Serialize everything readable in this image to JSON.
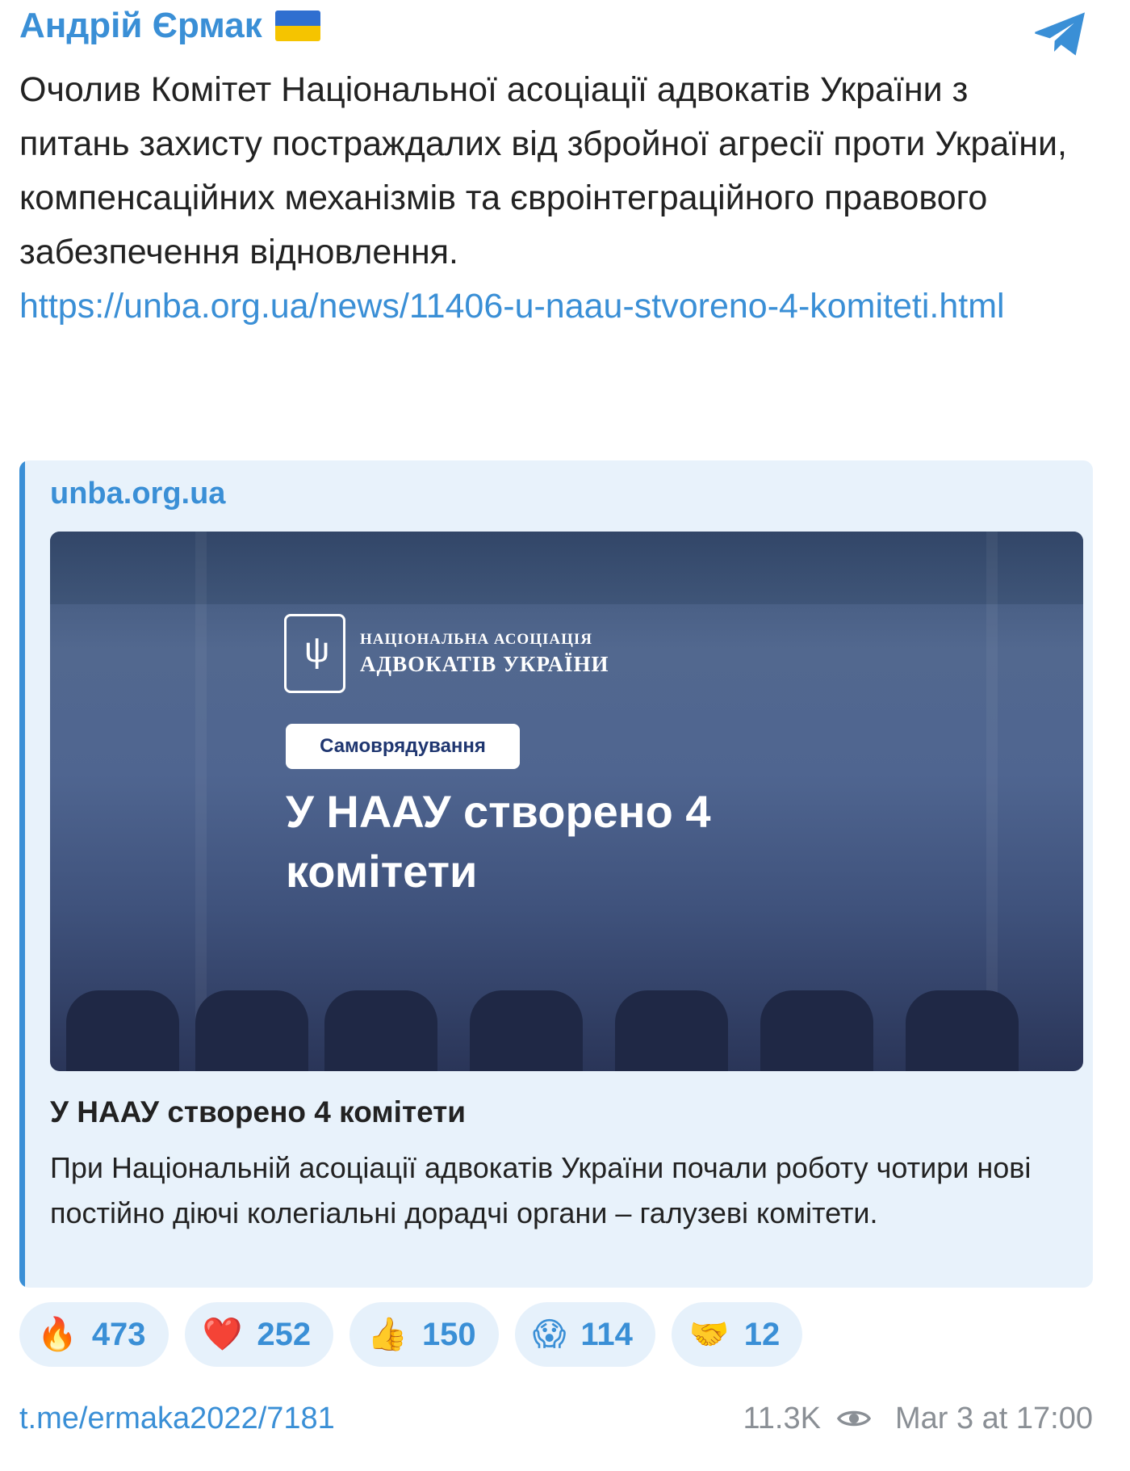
{
  "header": {
    "author": "Андрій Єрмак",
    "flag_icon": "ukraine-flag",
    "app_icon": "telegram-logo"
  },
  "message": {
    "text": "Очолив Комітет Національної асоціації адвокатів України з питань захисту постраждалих від збройної агресії проти України, компенсаційних механізмів та євроінтеграційного правового забезпечення відновлення.",
    "link": "https://unba.org.ua/news/11406-u-naau-stvoreno-4-komiteti.html"
  },
  "preview": {
    "site": "unba.org.ua",
    "image": {
      "logo_line1": "НАЦІОНАЛЬНА АСОЦІАЦІЯ",
      "logo_line2": "АДВОКАТІВ УКРАЇНИ",
      "category": "Самоврядування",
      "headline": "У НААУ створено 4 комітети"
    },
    "title": "У НААУ створено 4 комітети",
    "description": "При Національній асоціації адвокатів України почали роботу чотири нові постійно діючі колегіальні дорадчі органи – галузеві комітети."
  },
  "reactions": [
    {
      "emoji": "🔥",
      "count": "473"
    },
    {
      "emoji": "❤️",
      "count": "252"
    },
    {
      "emoji": "👍",
      "count": "150"
    },
    {
      "emoji": "😱",
      "count": "114"
    },
    {
      "emoji": "🤝",
      "count": "12"
    }
  ],
  "footer": {
    "post_link": "t.me/ermaka2022/7181",
    "views": "11.3K",
    "timestamp": "Mar 3 at 17:00"
  },
  "colors": {
    "accent": "#3a8fd6",
    "preview_bg": "#e8f2fb",
    "reaction_bg": "#e6f1fb",
    "meta_gray": "#8a8f95"
  }
}
